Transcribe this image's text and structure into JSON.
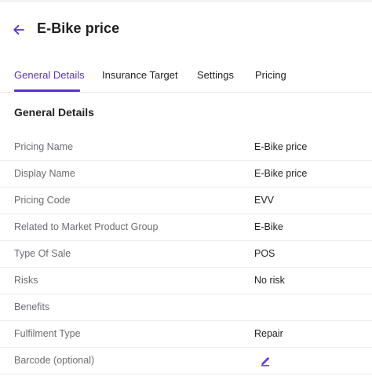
{
  "header": {
    "title": "E-Bike price",
    "back_icon": "arrow-left-icon",
    "accent_color": "#5a2fd6"
  },
  "tabs": [
    {
      "label": "General Details",
      "active": true
    },
    {
      "label": "Insurance Target",
      "active": false
    },
    {
      "label": "Settings",
      "active": false
    },
    {
      "label": "Pricing",
      "active": false
    }
  ],
  "section": {
    "title": "General Details"
  },
  "rows": [
    {
      "label": "Pricing Name",
      "value": "E-Bike price"
    },
    {
      "label": "Display Name",
      "value": "E-Bike price"
    },
    {
      "label": "Pricing Code",
      "value": "EVV"
    },
    {
      "label": "Related to Market Product Group",
      "value": "E-Bike"
    },
    {
      "label": "Type Of Sale",
      "value": "POS"
    },
    {
      "label": "Risks",
      "value": "No risk"
    },
    {
      "label": "Benefits",
      "value": ""
    },
    {
      "label": "Fulfilment Type",
      "value": "Repair"
    },
    {
      "label": "Barcode (optional)",
      "value": "",
      "icon": "pencil-edit-icon"
    }
  ]
}
